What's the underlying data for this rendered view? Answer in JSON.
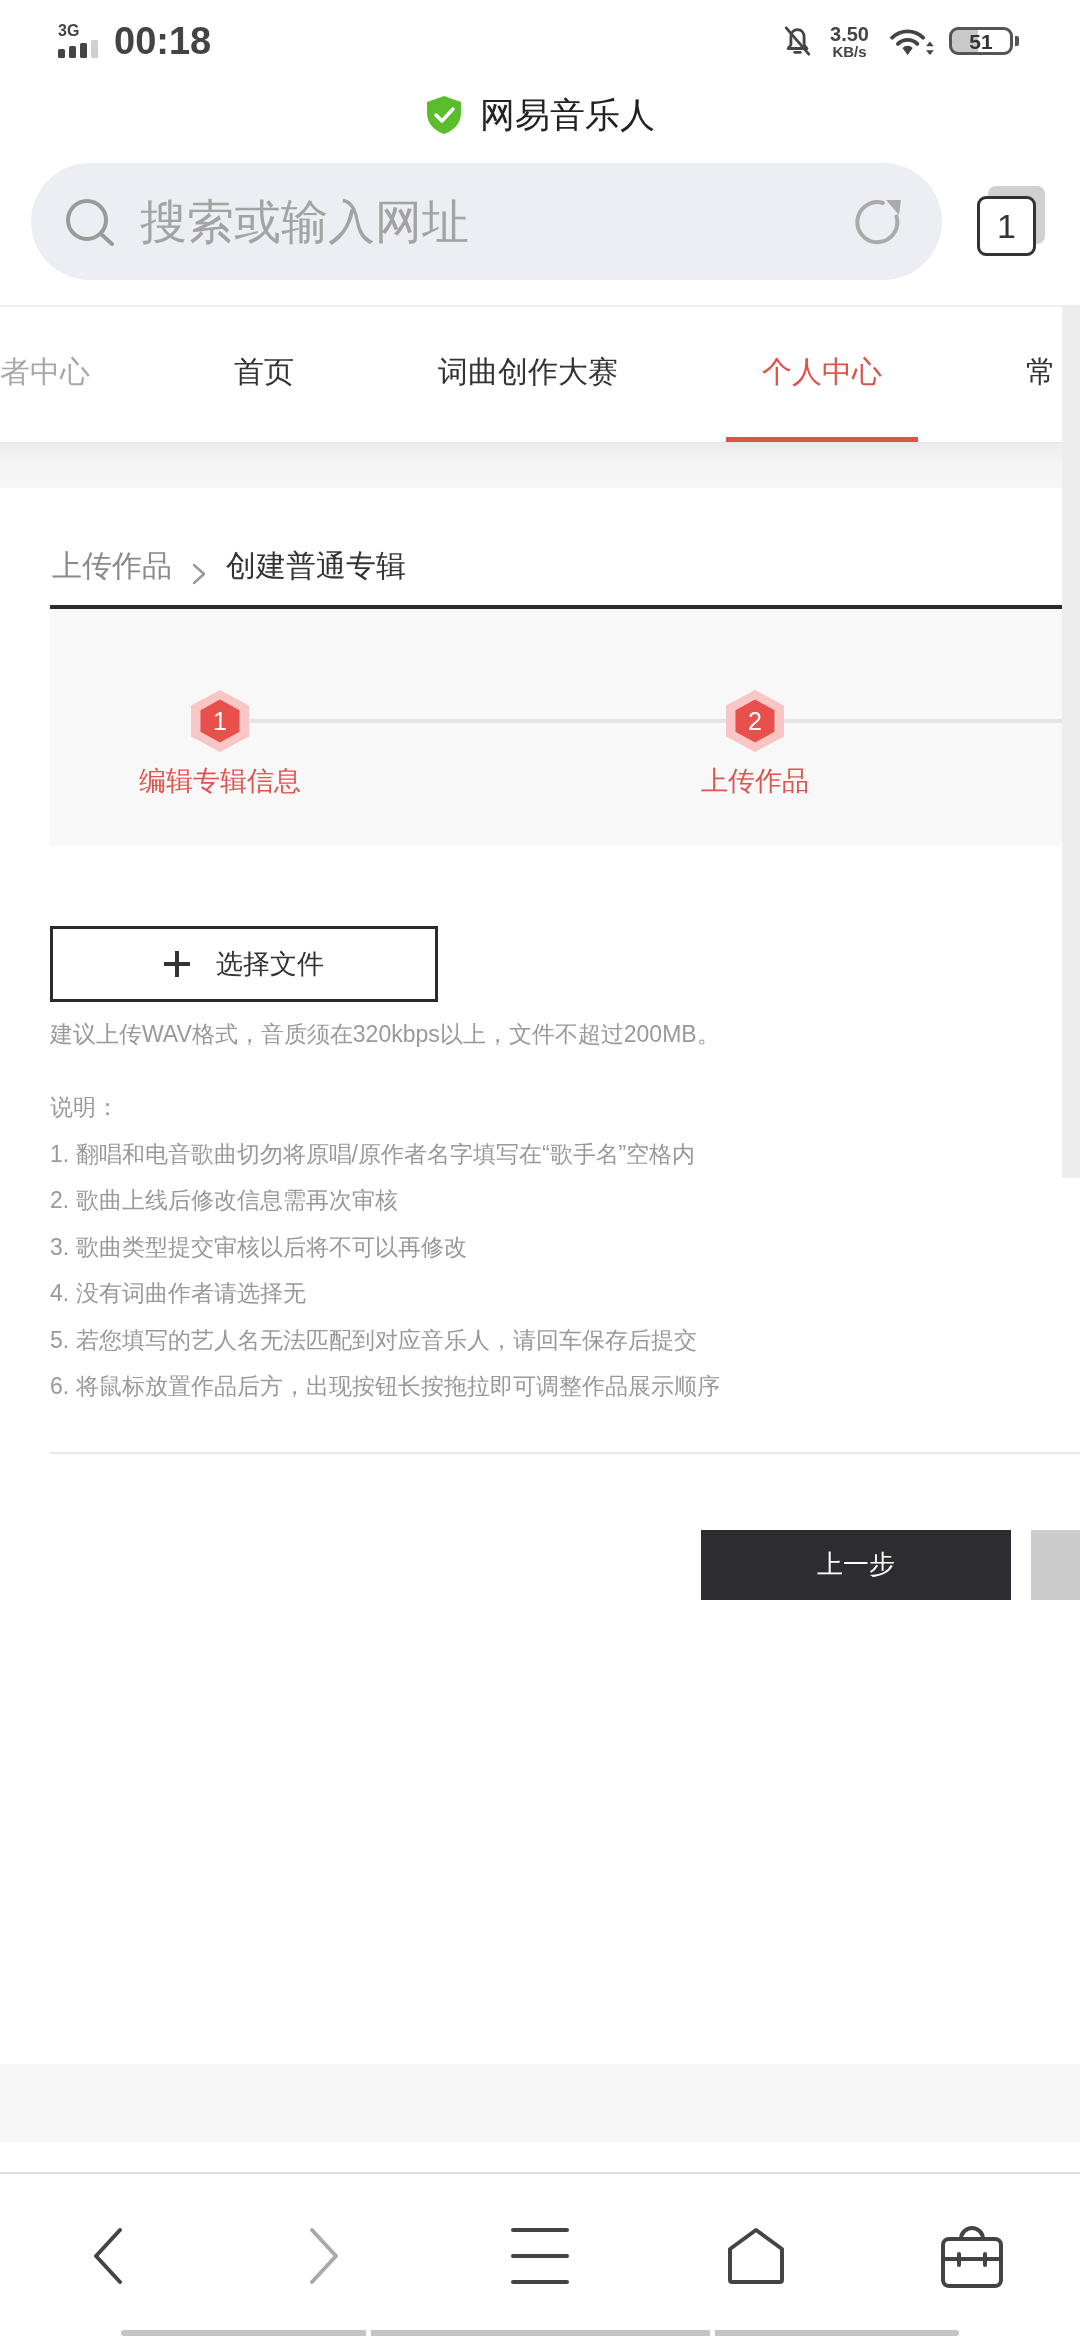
{
  "status_bar": {
    "network": "3G",
    "time": "00:18",
    "speed": "3.50",
    "speed_unit": "KB/s",
    "battery": "51"
  },
  "title_bar": {
    "title": "网易音乐人",
    "verified": true
  },
  "address_bar": {
    "placeholder": "搜索或输入网址",
    "tab_count": "1"
  },
  "nav_tabs": [
    {
      "label": "者中心",
      "selected": false,
      "faded": true
    },
    {
      "label": "首页",
      "selected": false,
      "faded": false
    },
    {
      "label": "词曲创作大赛",
      "selected": false,
      "faded": false
    },
    {
      "label": "个人中心",
      "selected": true,
      "faded": false
    },
    {
      "label": "常",
      "selected": false,
      "faded": false
    }
  ],
  "breadcrumb": [
    {
      "label": "上传作品",
      "current": false
    },
    {
      "label": "创建普通专辑",
      "current": true
    }
  ],
  "steps": [
    {
      "number": "1",
      "label": "编辑专辑信息",
      "active": true
    },
    {
      "number": "2",
      "label": "上传作品",
      "active": true
    }
  ],
  "upload": {
    "button": "选择文件",
    "hint": "建议上传WAV格式，音质须在320kbps以上，文件不超过200MB。"
  },
  "notes": {
    "heading": "说明：",
    "items": [
      "1. 翻唱和电音歌曲切勿将原唱/原作者名字填写在“歌手名”空格内",
      "2. 歌曲上线后修改信息需再次审核",
      "3. 歌曲类型提交审核以后将不可以再修改",
      "4. 没有词曲作者请选择无",
      "5. 若您填写的艺人名无法匹配到对应音乐人，请回车保存后提交",
      "6. 将鼠标放置作品后方，出现按钮长按拖拉即可调整作品展示顺序"
    ]
  },
  "buttons": [
    {
      "label": "上一步",
      "disabled": false
    },
    {
      "disabled": true
    }
  ],
  "toolbar": [
    {
      "kind": "back",
      "disabled": false
    },
    {
      "kind": "forward",
      "disabled": true
    },
    {
      "kind": "menu",
      "disabled": false
    },
    {
      "kind": "home",
      "disabled": false
    },
    {
      "kind": "toolbox",
      "disabled": false
    }
  ]
}
